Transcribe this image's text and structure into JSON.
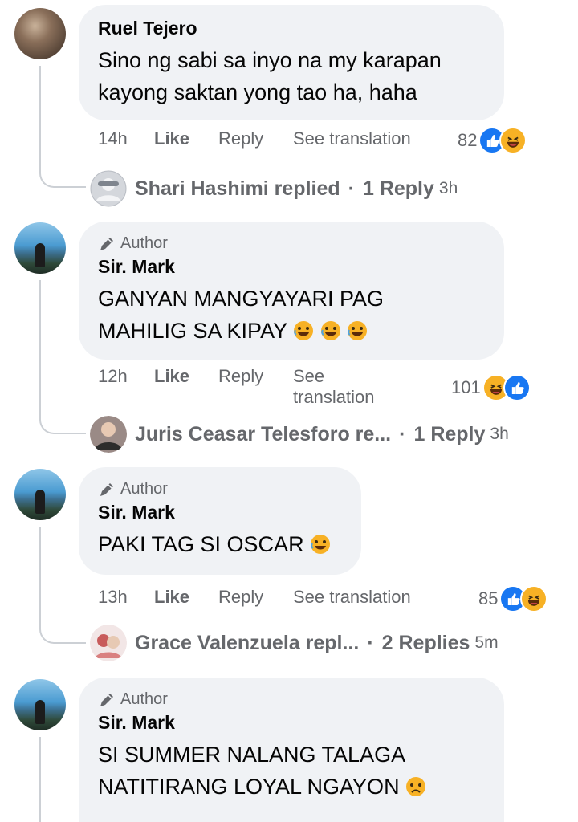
{
  "comments": [
    {
      "author": "Ruel Tejero",
      "is_author": false,
      "text_lines": [
        "Sino ng sabi sa inyo na my karapan",
        "kayong saktan yong tao ha, haha"
      ],
      "time": "14h",
      "like": "Like",
      "reply": "Reply",
      "see_translation": "See translation",
      "reaction_count": "82",
      "reactions": [
        "like-icon",
        "haha-icon"
      ],
      "replies_summary": {
        "name": "Shari Hashimi replied",
        "sep": "·",
        "count": "1 Reply",
        "time": "3h"
      }
    },
    {
      "author": "Sir. Mark",
      "is_author": true,
      "author_badge": "Author",
      "text_lines": [
        "GANYAN MANGYAYARI PAG",
        "MAHILIG SA KIPAY"
      ],
      "text_emojis": [
        "rofl-emoji",
        "rofl-emoji",
        "rofl-emoji"
      ],
      "time": "12h",
      "like": "Like",
      "reply": "Reply",
      "see_translation_lines": [
        "See",
        "translation"
      ],
      "reaction_count": "101",
      "reactions": [
        "haha-icon",
        "like-icon"
      ],
      "replies_summary": {
        "name": "Juris Ceasar Telesforo re...",
        "sep": "·",
        "count": "1 Reply",
        "time": "3h"
      }
    },
    {
      "author": "Sir. Mark",
      "is_author": true,
      "author_badge": "Author",
      "text_lines": [
        "PAKI TAG SI OSCAR"
      ],
      "text_emojis": [
        "rofl-emoji"
      ],
      "time": "13h",
      "like": "Like",
      "reply": "Reply",
      "see_translation": "See translation",
      "reaction_count": "85",
      "reactions": [
        "like-icon",
        "haha-icon"
      ],
      "replies_summary": {
        "name": "Grace Valenzuela repl...",
        "sep": "·",
        "count": "2 Replies",
        "time": "5m"
      }
    },
    {
      "author": "Sir. Mark",
      "is_author": true,
      "author_badge": "Author",
      "text_lines": [
        "SI SUMMER NALANG TALAGA",
        "NATITIRANG LOYAL NGAYON"
      ],
      "text_emojis": [
        "sad-emoji"
      ]
    }
  ],
  "colors": {
    "bubble": "#f0f2f5",
    "meta_text": "#65676b",
    "like_blue": "#1877f2",
    "haha_yellow": "#f7b125"
  }
}
